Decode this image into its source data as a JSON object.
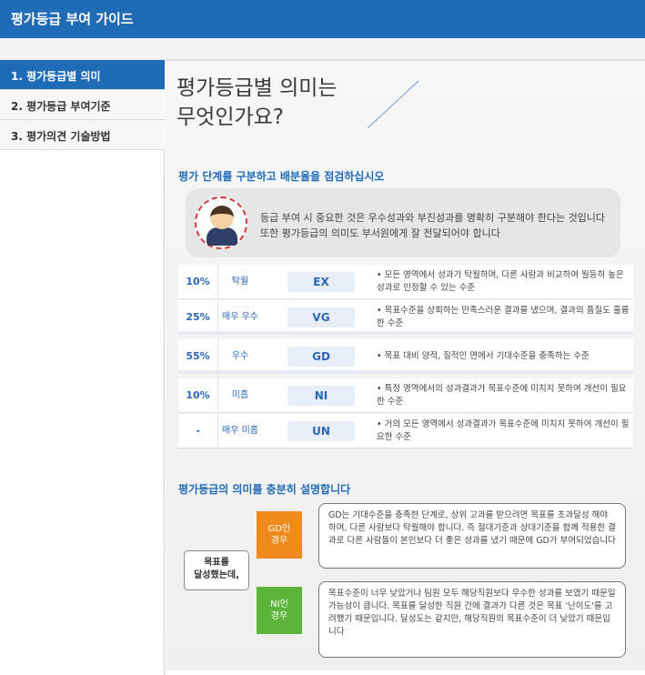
{
  "header": {
    "title": "평가등급 부여 가이드"
  },
  "sidebar": {
    "items": [
      {
        "label": "1. 평가등급별 의미"
      },
      {
        "label": "2. 평가등급 부여기준"
      },
      {
        "label": "3. 평가의견 기술방법"
      }
    ]
  },
  "main": {
    "title_line1": "평가등급별 의미는",
    "title_line2": "무엇인가요?",
    "section1_title": "평가 단계를 구분하고 배분율을 점검하십시오",
    "note_line1": "등급 부여 시 중요한 것은 우수성과와 부진성과를 명확히 구분해야 한다는 것입니다",
    "note_line2": "또한 평가등급의 의미도 부서원에게 잘 전달되어야 합니다",
    "grades": [
      {
        "pct": "10%",
        "label": "탁월",
        "code": "EX",
        "desc": "• 모든 영역에서 성과가 탁월하며, 다른 사람과 비교하여 월등히 높은 성과로 인정할 수 있는 수준"
      },
      {
        "pct": "25%",
        "label": "매우 우수",
        "code": "VG",
        "desc": "• 목표수준을 상회하는 만족스러운 결과를 냈으며, 결과의 품질도 훌륭한 수준"
      },
      {
        "pct": "55%",
        "label": "우수",
        "code": "GD",
        "desc": "• 목표 대비 양적, 질적인 면에서 기대수준을 충족하는 수준"
      },
      {
        "pct": "10%",
        "label": "미흡",
        "code": "NI",
        "desc": "• 특정 영역에서의 성과결과가 목표수준에 미치지 못하여 개선이 필요한 수준"
      },
      {
        "pct": "-",
        "label": "매우 미흡",
        "code": "UN",
        "desc": "• 거의 모든 영역에서 성과결과가 목표수준에 미치지 못하여 개선이 필요한 수준"
      }
    ],
    "section2_title": "평가등급의 의미를 충분히 설명합니다",
    "goal_label_1": "목표를",
    "goal_label_2": "달성했는데,",
    "tag_gd_1": "GD인",
    "tag_gd_2": "경우",
    "tag_ni_1": "NI인",
    "tag_ni_2": "경우",
    "bubble_gd": "GD는 기대수준을 충족한 단계로, 상위 고과를 받으려면 목표를 초과달성 해야 하며, 다른 사람보다 탁월해야 합니다. 즉 절대기준과 상대기준을 함께 적용한 결과로 다른 사람들이 본인보다 더 좋은 성과를 냈기 때문에 GD가 부여되었습니다",
    "bubble_ni": "목표수준이 너무 낮았거나 팀원 모두 해당직원보다 우수한 성과를 보였기 때문일 가능성이 큽니다. 목표를 달성한 직원 간에 결과가 다른 것은 목표 '난이도'를 고려했기 때문입니다. 달성도는 같지만, 해당직원의 목표수준이 더 낮았기 때문입니다"
  },
  "colors": {
    "primary": "#1f6bb5",
    "orange": "#f08a1c",
    "green": "#5cb43a"
  }
}
